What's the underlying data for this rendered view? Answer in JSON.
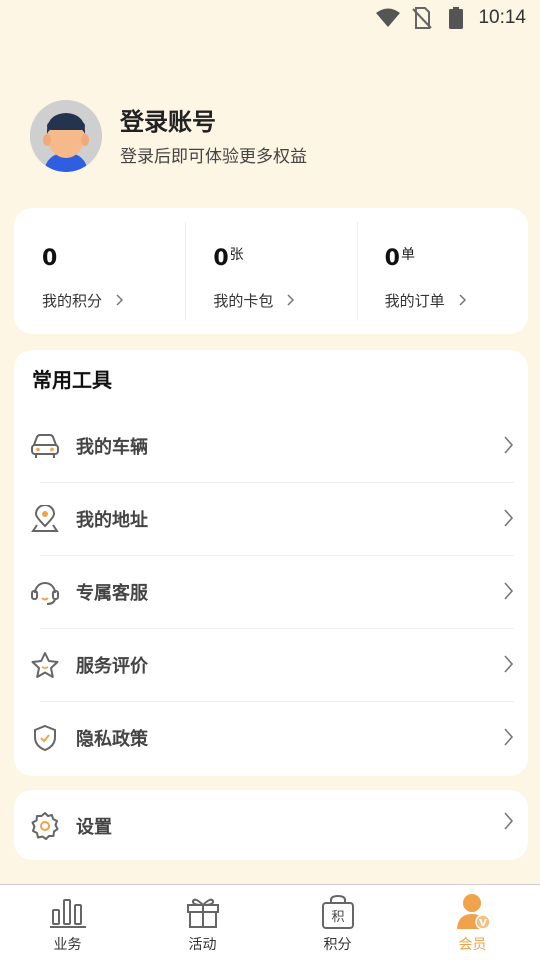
{
  "status_bar": {
    "time": "10:14"
  },
  "profile": {
    "title": "登录账号",
    "subtitle": "登录后即可体验更多权益"
  },
  "stats": [
    {
      "value": "0",
      "unit": "",
      "label": "我的积分"
    },
    {
      "value": "0",
      "unit": "张",
      "label": "我的卡包"
    },
    {
      "value": "0",
      "unit": "单",
      "label": "我的订单"
    }
  ],
  "tools": {
    "title": "常用工具",
    "items": [
      {
        "label": "我的车辆",
        "icon": "car-icon"
      },
      {
        "label": "我的地址",
        "icon": "location-pin-icon"
      },
      {
        "label": "专属客服",
        "icon": "headset-icon"
      },
      {
        "label": "服务评价",
        "icon": "star-icon"
      },
      {
        "label": "隐私政策",
        "icon": "shield-icon"
      }
    ]
  },
  "settings": {
    "label": "设置",
    "icon": "gear-icon"
  },
  "tabbar": {
    "items": [
      {
        "label": "业务",
        "icon": "bar-chart-icon",
        "active": false
      },
      {
        "label": "活动",
        "icon": "gift-icon",
        "active": false
      },
      {
        "label": "积分",
        "icon": "points-bag-icon",
        "active": false,
        "glyph": "积"
      },
      {
        "label": "会员",
        "icon": "member-icon",
        "active": true,
        "badge": "V"
      }
    ]
  },
  "colors": {
    "background": "#fdf6e4",
    "accent": "#f0a24c",
    "card": "#ffffff",
    "icon": "#666666"
  }
}
